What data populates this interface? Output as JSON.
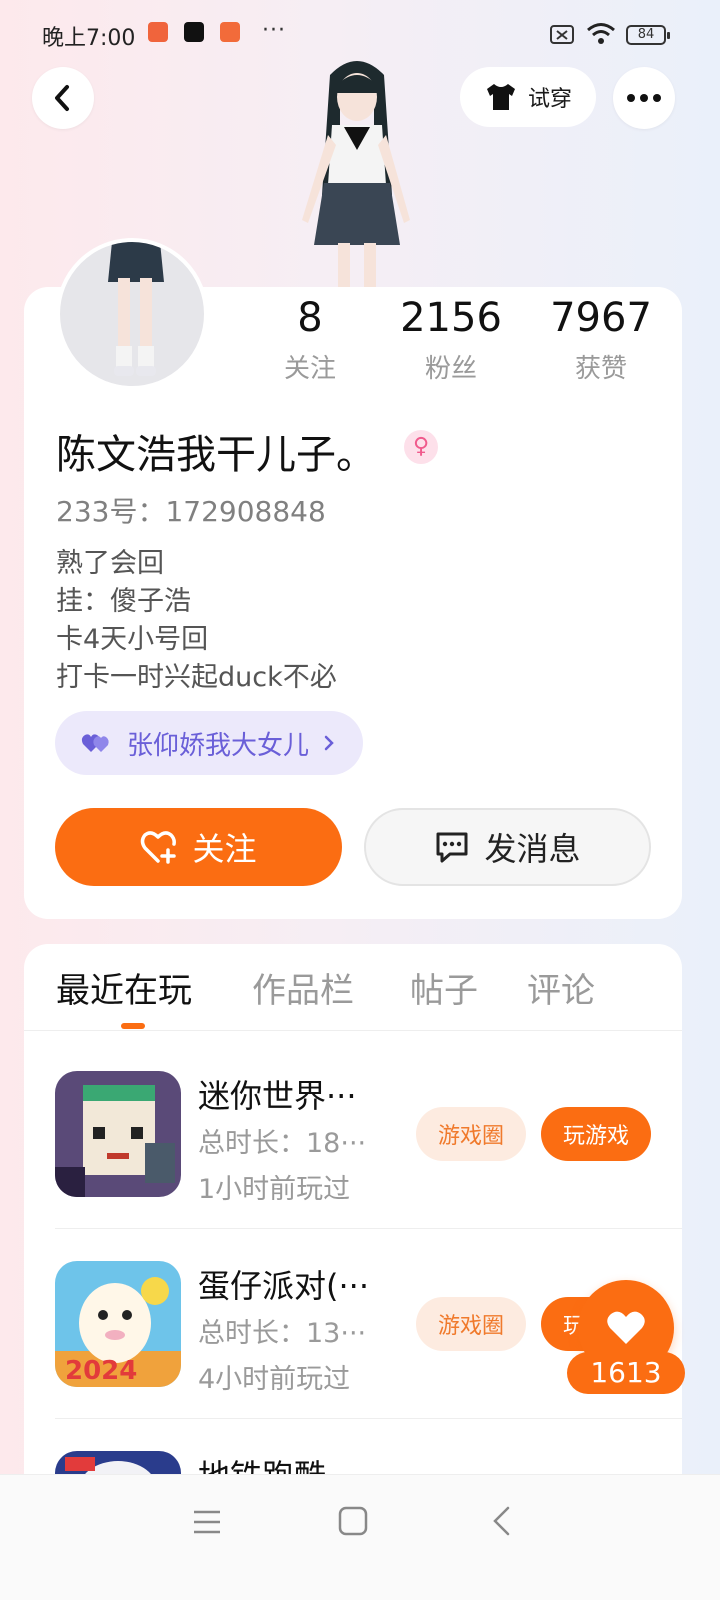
{
  "status_bar": {
    "time": "晚上7:00",
    "more": "···",
    "battery": "84"
  },
  "header": {
    "tryon_label": "试穿"
  },
  "profile": {
    "stats": [
      {
        "num": "8",
        "label": "关注"
      },
      {
        "num": "2156",
        "label": "粉丝"
      },
      {
        "num": "7967",
        "label": "获赞"
      }
    ],
    "name": "陈文浩我干儿子。",
    "gender_symbol": "♀",
    "uid": "233号：172908848",
    "bio": [
      "熟了会回",
      "挂：傻子浩",
      "卡4天小号回",
      "打卡一时兴起duck不必"
    ],
    "relation": "张仰娇我大女儿",
    "follow_label": "关注",
    "message_label": "发消息"
  },
  "tabs": [
    {
      "label": "最近在玩"
    },
    {
      "label": "作品栏"
    },
    {
      "label": "帖子"
    },
    {
      "label": "评论"
    }
  ],
  "games": [
    {
      "title": "迷你世界···",
      "duration": "总时长：18···",
      "ago": "1小时前玩过",
      "circle_label": "游戏圈",
      "play_label": "玩游戏"
    },
    {
      "title": "蛋仔派对(···",
      "duration": "总时长：13···",
      "ago": "4小时前玩过",
      "circle_label": "游戏圈",
      "play_label": "玩游戏"
    },
    {
      "title": "地铁跑酷···"
    }
  ],
  "like_fab": {
    "count": "1613"
  },
  "colors": {
    "accent": "#fb6d12",
    "relation_bg": "#ece9fb",
    "relation_text": "#6a5fd8"
  }
}
